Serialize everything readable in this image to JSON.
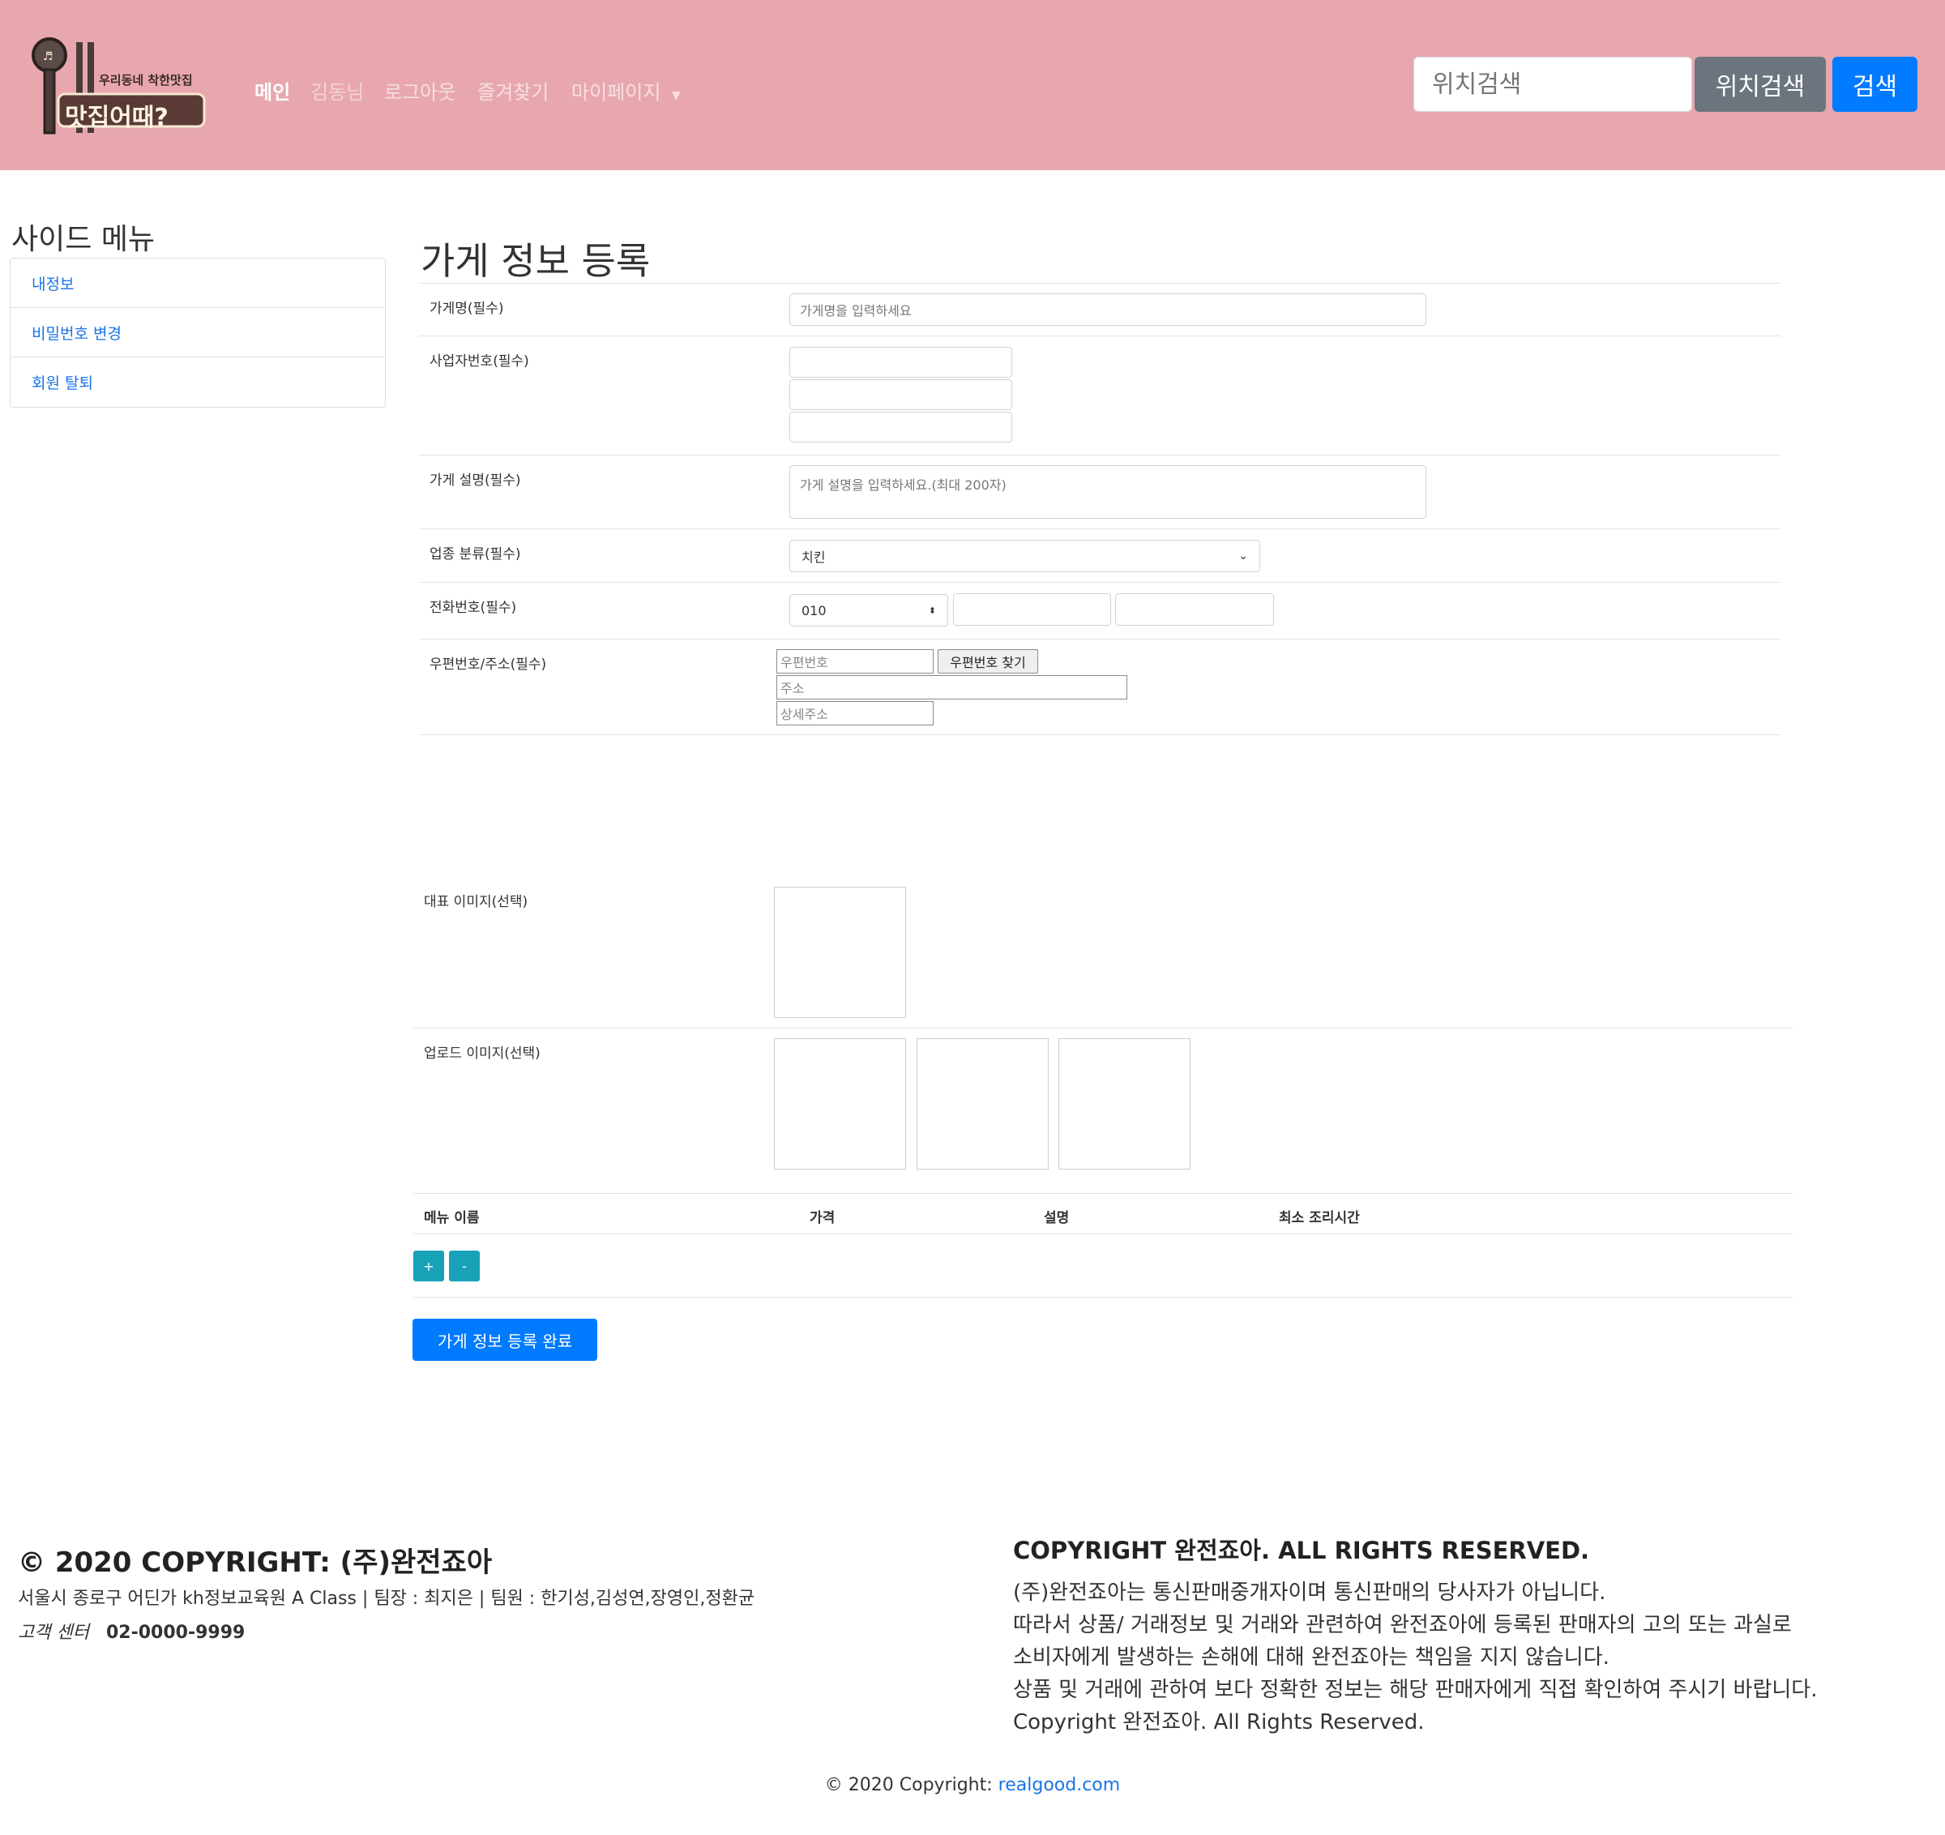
{
  "header": {
    "logo_text": "맛집어때?",
    "logo_tagline": "우리동네 착한맛집",
    "nav": [
      "메인",
      "김동님",
      "로그아웃",
      "즐겨찾기",
      "마이페이지"
    ],
    "search_placeholder": "위치검색",
    "location_search_button": "위치검색",
    "search_button": "검색"
  },
  "sidebar": {
    "title": "사이드 메뉴",
    "items": [
      "내정보",
      "비밀번호 변경",
      "회원 탈퇴"
    ]
  },
  "form": {
    "title": "가게 정보 등록",
    "store_name_label": "가게명(필수)",
    "store_name_placeholder": "가게명을 입력하세요",
    "biz_no_label": "사업자번호(필수)",
    "desc_label": "가게 설명(필수)",
    "desc_placeholder": "가게 설명을 입력하세요.(최대 200자)",
    "category_label": "업종 분류(필수)",
    "category_value": "치킨",
    "phone_label": "전화번호(필수)",
    "phone_prefix": "010",
    "address_label": "우편번호/주소(필수)",
    "postcode_placeholder": "우편번호",
    "postcode_button": "우편번호 찾기",
    "address_placeholder": "주소",
    "address_detail_placeholder": "상세주소",
    "main_image_label": "대표 이미지(선택)",
    "upload_image_label": "업로드 이미지(선택)",
    "menu_headers": [
      "메뉴 이름",
      "가격",
      "설명",
      "최소 조리시간"
    ],
    "add_button": "+",
    "remove_button": "-",
    "submit_button": "가게 정보 등록 완료"
  },
  "footer": {
    "left_title": "© 2020 COPYRIGHT: (주)완전죠아",
    "left_address": "서울시 종로구 어딘가 kh정보교육원 A Class | 팀장 : 최지은 | 팀원 : 한기성,김성연,장영인,정환균",
    "cs_label": "고객 센터",
    "cs_phone": "02-0000-9999",
    "right_title": "COPYRIGHT 완전죠아. ALL RIGHTS RESERVED.",
    "right_lines": [
      "(주)완전죠아는 통신판매중개자이며 통신판매의 당사자가 아닙니다.",
      "따라서 상품/ 거래정보 및 거래와 관련하여 완전죠아에 등록된 판매자의 고의 또는 과실로",
      "소비자에게 발생하는 손해에 대해 완전죠아는 책임을 지지 않습니다.",
      "상품 및 거래에 관하여 보다 정확한 정보는 해당 판매자에게 직접 확인하여 주시기 바랍니다.",
      "Copyright 완전죠아. All Rights Reserved."
    ],
    "copyright_prefix": "© 2020 Copyright: ",
    "copyright_link": "realgood.com"
  },
  "colors": {
    "header_bg": "#e8a7ae",
    "primary": "#007bff",
    "secondary": "#6c757d",
    "info": "#17a2b8",
    "link": "#1a73e8"
  }
}
